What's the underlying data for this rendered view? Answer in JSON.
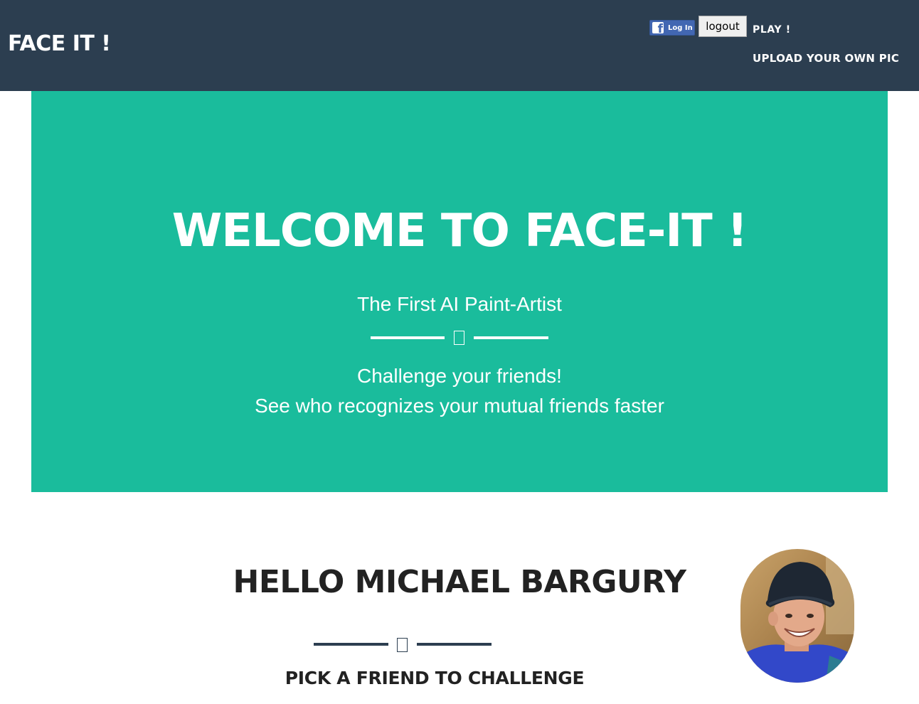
{
  "header": {
    "brand": "FACE IT !",
    "fb_login_label": "Log In",
    "logout_label": "logout",
    "nav": {
      "play": "PLAY !",
      "upload": "UPLOAD YOUR OWN PIC"
    }
  },
  "hero": {
    "title": "WELCOME TO FACE-IT !",
    "subtitle": "The First AI Paint-Artist",
    "line1": "Challenge your friends!",
    "line2": "See who recognizes your mutual friends faster"
  },
  "profile": {
    "greeting": "HELLO MICHAEL BARGURY",
    "prompt": "PICK A FRIEND TO CHALLENGE"
  },
  "icons": {
    "divider_glyph": "missing-glyph-icon",
    "facebook": "facebook-f-icon"
  },
  "colors": {
    "navbar": "#2c3e50",
    "hero": "#1abc9c",
    "text_dark": "#222222",
    "white": "#ffffff"
  }
}
